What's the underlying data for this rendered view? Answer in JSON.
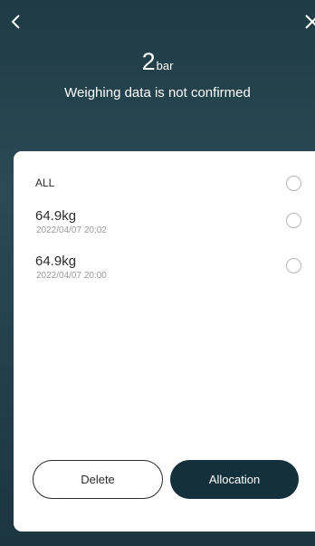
{
  "header": {
    "count": "2",
    "unit": "bar",
    "status_text": "Weighing data is not confirmed"
  },
  "list": {
    "all_label": "ALL",
    "items": [
      {
        "weight": "64.9kg",
        "datetime": "2022/04/07 20:02"
      },
      {
        "weight": "64.9kg",
        "datetime": "2022/04/07 20:00"
      }
    ]
  },
  "actions": {
    "delete_label": "Delete",
    "allocation_label": "Allocation"
  },
  "icons": {
    "back": "chevron-left-icon",
    "close": "close-icon"
  },
  "colors": {
    "header_bg": "#243f49",
    "primary_button": "#14303a"
  }
}
